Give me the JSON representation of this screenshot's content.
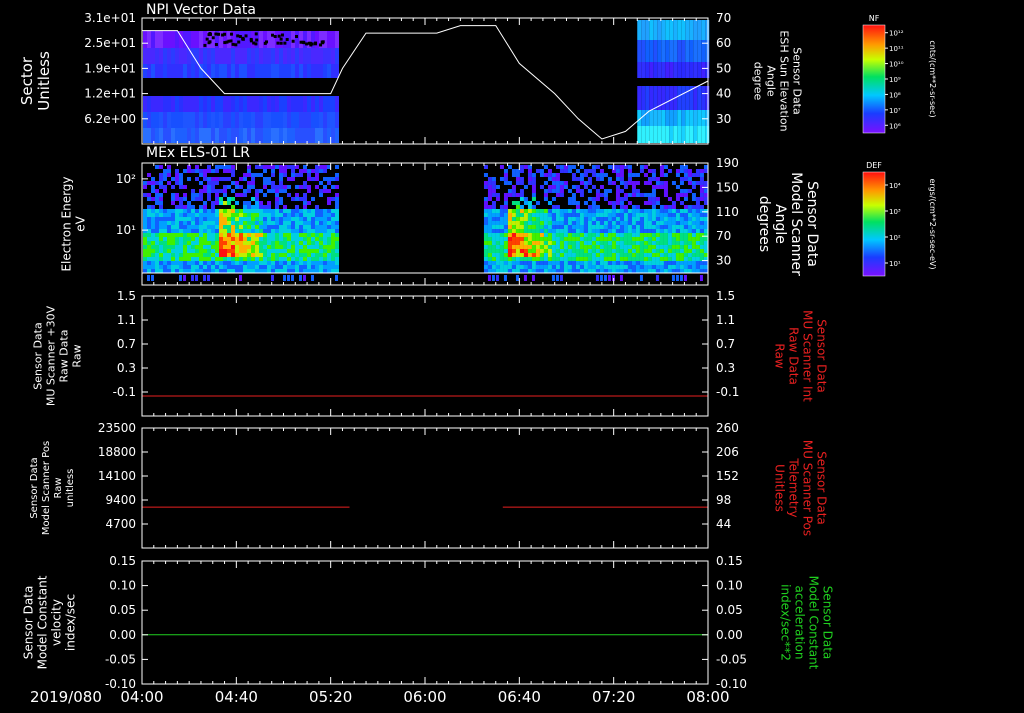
{
  "chart_data": [
    {
      "type": "heatmap",
      "title": "NPI Vector Data",
      "ylabel_left": [
        "Sector",
        "Unitless"
      ],
      "yticks_left": [
        "3.1e+01",
        "2.5e+01",
        "1.9e+01",
        "1.2e+01",
        "6.2e+00"
      ],
      "ylabel_right": [
        "Sensor Data",
        "ESH Sun Elevation",
        "Angle",
        "degree"
      ],
      "yticks_right": [
        "70",
        "60",
        "50",
        "40",
        "30"
      ],
      "ylim_right": [
        20,
        70
      ],
      "line": {
        "name": "ESH Sun Elevation Angle",
        "x": [
          "04:00",
          "04:15",
          "04:25",
          "04:35",
          "05:00",
          "05:20",
          "05:25",
          "05:35",
          "05:45",
          "06:05",
          "06:15",
          "06:25",
          "06:30",
          "06:40",
          "06:55",
          "07:05",
          "07:15",
          "07:25",
          "07:35",
          "08:00"
        ],
        "y": [
          65,
          65,
          50,
          40,
          40,
          40,
          50,
          64,
          64,
          64,
          67,
          67,
          67,
          52,
          40,
          30,
          22,
          25,
          33,
          45
        ]
      },
      "colorbar": {
        "label": "NF",
        "unit": "cnts/(cm**2-sr-sec)",
        "ticks": [
          "10¹²",
          "10¹¹",
          "10¹⁰",
          "10⁹",
          "10⁸",
          "10⁷",
          "10⁶"
        ]
      },
      "data_gaps": [
        [
          "05:22",
          "07:30"
        ]
      ]
    },
    {
      "type": "heatmap",
      "title": "MEx ELS-01 LR",
      "ylabel_left": [
        "Electron Energy",
        "eV"
      ],
      "yticks_left": [
        "10²",
        "10¹"
      ],
      "ylabel_right": [
        "Sensor Data",
        "Model Scanner",
        "Angle",
        "degrees"
      ],
      "yticks_right": [
        "190",
        "150",
        "110",
        "70",
        "30"
      ],
      "colorbar": {
        "label": "DEF",
        "unit": "ergs/(cm**2-sr-sec-eV)",
        "ticks": [
          "10⁴",
          "10³",
          "10²",
          "10¹"
        ]
      },
      "data_gaps": [
        [
          "05:23",
          "06:25"
        ]
      ]
    },
    {
      "type": "line",
      "ylabel_left": [
        "Sensor Data",
        "MU Scanner +30V",
        "Raw Data",
        "Raw"
      ],
      "yticks_left": [
        "1.5",
        "1.1",
        "0.7",
        "0.3",
        "-0.1"
      ],
      "ylim": [
        -0.3,
        1.5
      ],
      "ylabel_right": [
        "Sensor Data",
        "MU Scanner Int",
        "Raw Data",
        "Raw"
      ],
      "yticks_right": [
        "1.5",
        "1.1",
        "0.7",
        "0.3",
        "-0.1"
      ],
      "series": [
        {
          "x": [
            "04:00",
            "08:00"
          ],
          "y": [
            0,
            0
          ],
          "color": "#e82020"
        }
      ]
    },
    {
      "type": "line",
      "ylabel_left": [
        "Sensor Data",
        "Model Scanner Pos",
        "Raw",
        "unitless"
      ],
      "yticks_left": [
        "23500",
        "18800",
        "14100",
        "9400",
        "4700"
      ],
      "ylim": [
        0,
        23500
      ],
      "ylabel_right": [
        "Sensor Data",
        "MU Scanner Pos",
        "Telemetry",
        "Unitless"
      ],
      "yticks_right": [
        "260",
        "206",
        "152",
        "98",
        "44"
      ],
      "series": [
        {
          "x": [
            "04:00",
            "05:28"
          ],
          "y": [
            8000,
            8000
          ],
          "color": "#e82020"
        },
        {
          "x": [
            "06:33",
            "08:00"
          ],
          "y": [
            8000,
            8000
          ],
          "color": "#e82020"
        }
      ]
    },
    {
      "type": "line",
      "ylabel_left": [
        "Sensor Data",
        "Model Constant",
        "velocity",
        "index/sec"
      ],
      "yticks_left": [
        "0.15",
        "0.10",
        "0.05",
        "0.00",
        "-0.05",
        "-0.10"
      ],
      "ylim": [
        -0.1,
        0.15
      ],
      "ylabel_right": [
        "Sensor Data",
        "Model Constant",
        "acceleration",
        "index/sec**2"
      ],
      "yticks_right": [
        "0.15",
        "0.10",
        "0.05",
        "0.00",
        "-0.05",
        "-0.10"
      ],
      "series": [
        {
          "x": [
            "04:00",
            "08:00"
          ],
          "y": [
            0,
            0
          ],
          "color": "#20d020"
        }
      ]
    }
  ],
  "xaxis": {
    "date": "2019/080",
    "ticks": [
      "04:00",
      "04:40",
      "05:20",
      "06:00",
      "06:40",
      "07:20",
      "08:00"
    ],
    "range": [
      "04:00",
      "08:00"
    ]
  },
  "colors": {
    "background": "#000000",
    "axes": "#ffffff",
    "red": "#e82020",
    "green": "#20d020"
  }
}
